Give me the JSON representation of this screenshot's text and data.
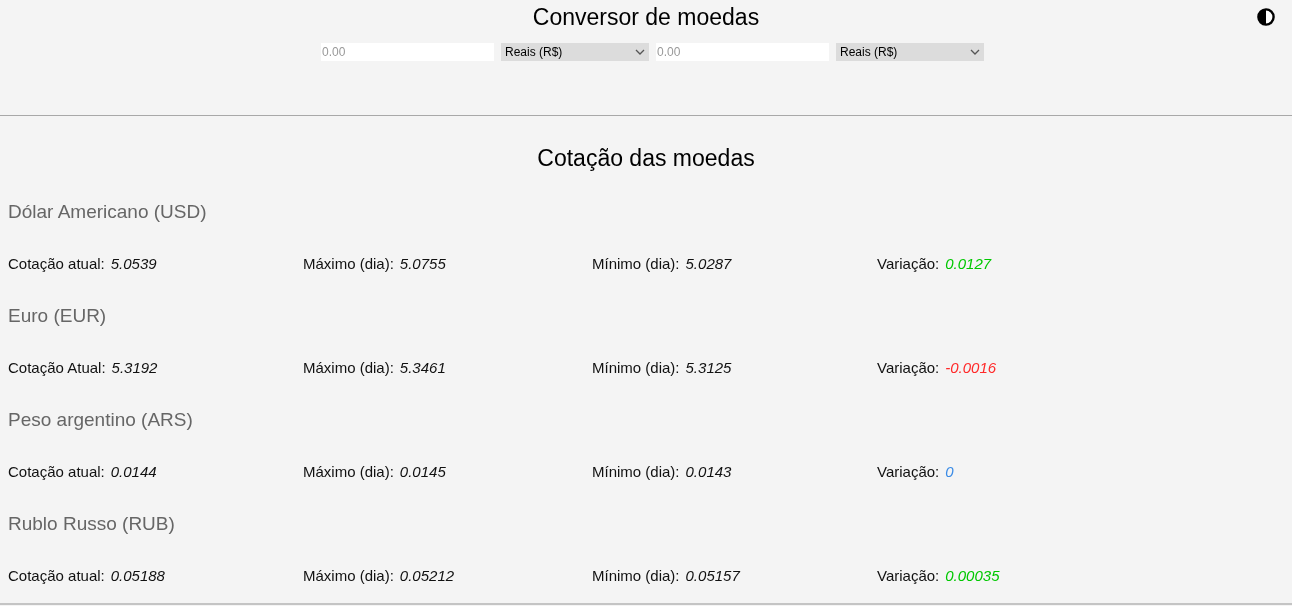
{
  "header": {
    "title": "Conversor de moedas",
    "converter": [
      {
        "kind": "amount",
        "placeholder": "0.00"
      },
      {
        "kind": "currency",
        "value": "Reais (R$)"
      },
      {
        "kind": "amount",
        "placeholder": "0.00"
      },
      {
        "kind": "currency",
        "value": "Reais (R$)"
      }
    ]
  },
  "quotes": {
    "title": "Cotação das moedas",
    "currencies": [
      {
        "name": "Dólar Americano (USD)",
        "stats": [
          {
            "label": "Cotação atual:",
            "value": "5.0539"
          },
          {
            "label": "Máximo (dia):",
            "value": "5.0755"
          },
          {
            "label": "Mínimo (dia):",
            "value": "5.0287"
          },
          {
            "label": "Variação:",
            "value": "0.0127",
            "color": "#00c800"
          }
        ]
      },
      {
        "name": "Euro (EUR)",
        "stats": [
          {
            "label": "Cotação Atual:",
            "value": "5.3192"
          },
          {
            "label": "Máximo (dia):",
            "value": "5.3461"
          },
          {
            "label": "Mínimo (dia):",
            "value": "5.3125"
          },
          {
            "label": "Variação:",
            "value": "-0.0016",
            "color": "#ff2a2a"
          }
        ]
      },
      {
        "name": "Peso argentino (ARS)",
        "stats": [
          {
            "label": "Cotação atual:",
            "value": "0.0144"
          },
          {
            "label": "Máximo (dia):",
            "value": "0.0145"
          },
          {
            "label": "Mínimo (dia):",
            "value": "0.0143"
          },
          {
            "label": "Variação:",
            "value": "0",
            "color": "#3c8ce6"
          }
        ]
      },
      {
        "name": "Rublo Russo (RUB)",
        "stats": [
          {
            "label": "Cotação atual:",
            "value": "0.05188"
          },
          {
            "label": "Máximo (dia):",
            "value": "0.05212"
          },
          {
            "label": "Mínimo (dia):",
            "value": "0.05157"
          },
          {
            "label": "Variação:",
            "value": "0.00035",
            "color": "#00c800"
          }
        ]
      }
    ]
  }
}
